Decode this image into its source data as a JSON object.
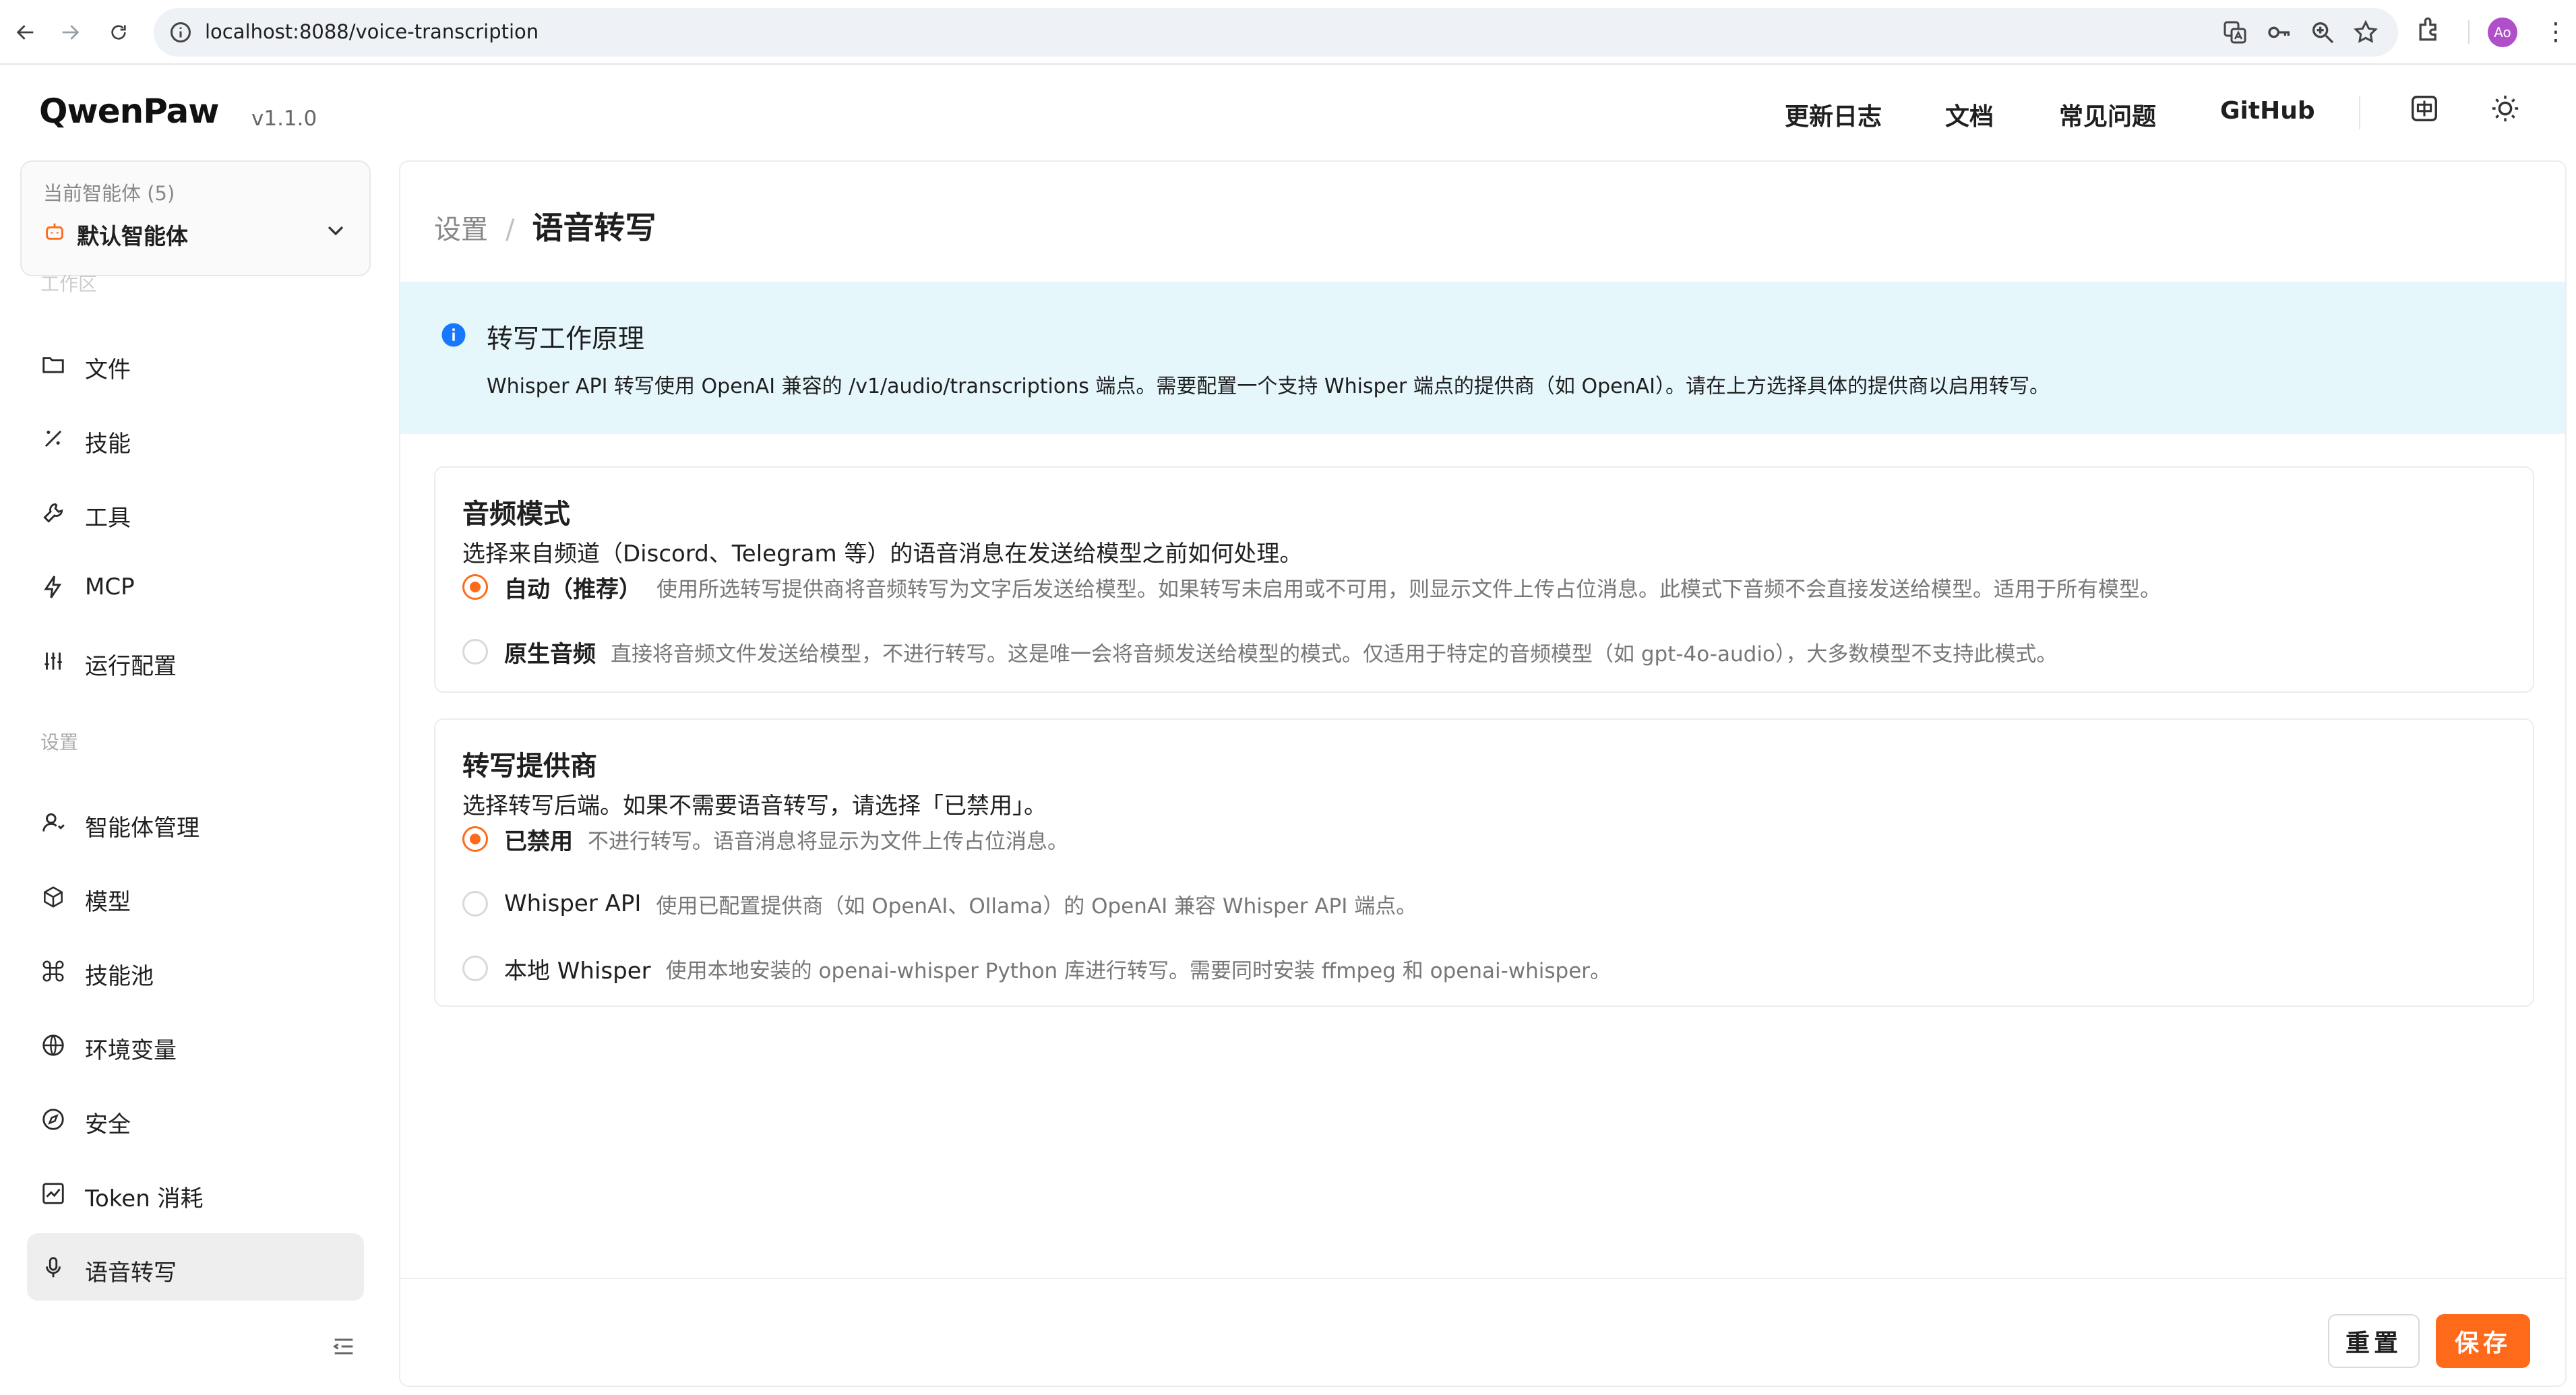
{
  "browser": {
    "url": "localhost:8088/voice-transcription",
    "profile_initials": "Ao"
  },
  "header": {
    "logo": "QwenPaw",
    "version": "v1.1.0",
    "nav": [
      "更新日志",
      "文档",
      "常见问题",
      "GitHub"
    ]
  },
  "sidebar": {
    "agent_label": "当前智能体 (5)",
    "agent_name": "默认智能体",
    "workspace_label": "工作区",
    "settings_label": "设置",
    "workspace_items": [
      {
        "label": "文件",
        "icon": "folder-icon"
      },
      {
        "label": "技能",
        "icon": "skill-icon"
      },
      {
        "label": "工具",
        "icon": "wrench-icon"
      },
      {
        "label": "MCP",
        "icon": "lightning-icon"
      },
      {
        "label": "运行配置",
        "icon": "sliders-icon"
      }
    ],
    "settings_items": [
      {
        "label": "智能体管理",
        "icon": "agent-icon"
      },
      {
        "label": "模型",
        "icon": "model-icon"
      },
      {
        "label": "技能池",
        "icon": "command-icon"
      },
      {
        "label": "环境变量",
        "icon": "globe-icon"
      },
      {
        "label": "安全",
        "icon": "compass-icon"
      },
      {
        "label": "Token 消耗",
        "icon": "chart-icon"
      },
      {
        "label": "语音转写",
        "icon": "microphone-icon"
      }
    ],
    "active_item": "语音转写"
  },
  "main": {
    "breadcrumb_parent": "设置",
    "breadcrumb_sep": "/",
    "breadcrumb_current": "语音转写",
    "info": {
      "title": "转写工作原理",
      "desc": "Whisper API 转写使用 OpenAI 兼容的 /v1/audio/transcriptions 端点。需要配置一个支持 Whisper 端点的提供商（如 OpenAI）。请在上方选择具体的提供商以启用转写。"
    },
    "audio_mode": {
      "title": "音频模式",
      "desc": "选择来自频道（Discord、Telegram 等）的语音消息在发送给模型之前如何处理。",
      "options": [
        {
          "label": "自动（推荐）",
          "desc": "使用所选转写提供商将音频转写为文字后发送给模型。如果转写未启用或不可用，则显示文件上传占位消息。此模式下音频不会直接发送给模型。适用于所有模型。",
          "checked": true
        },
        {
          "label": "原生音频",
          "desc": "直接将音频文件发送给模型，不进行转写。这是唯一会将音频发送给模型的模式。仅适用于特定的音频模型（如 gpt-4o-audio），大多数模型不支持此模式。",
          "checked": false
        }
      ]
    },
    "provider": {
      "title": "转写提供商",
      "desc": "选择转写后端。如果不需要语音转写，请选择「已禁用」。",
      "options": [
        {
          "label": "已禁用",
          "desc": "不进行转写。语音消息将显示为文件上传占位消息。",
          "checked": true
        },
        {
          "label": "Whisper API",
          "desc": "使用已配置提供商（如 OpenAI、Ollama）的 OpenAI 兼容 Whisper API 端点。",
          "checked": false
        },
        {
          "label": "本地 Whisper",
          "desc": "使用本地安装的 openai-whisper Python 库进行转写。需要同时安装 ffmpeg 和 openai-whisper。",
          "checked": false
        }
      ]
    },
    "buttons": {
      "reset": "重置",
      "save": "保存"
    }
  },
  "colors": {
    "accent": "#ff6a1a",
    "info_bg": "#e6f7fc",
    "info_icon": "#1677ff"
  }
}
